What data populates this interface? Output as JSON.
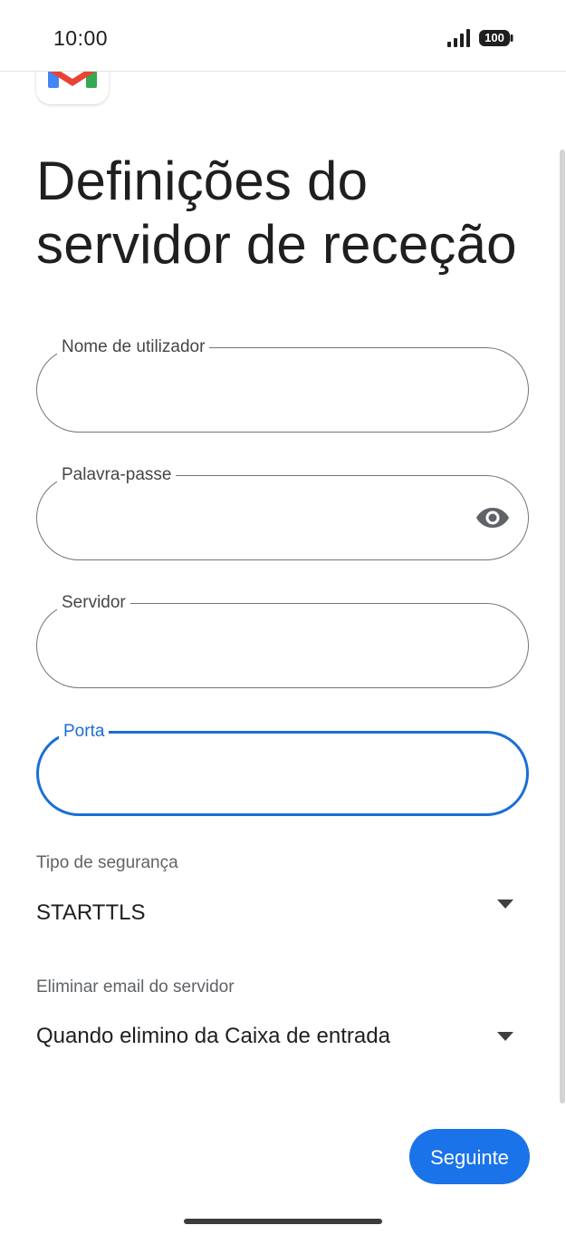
{
  "status_bar": {
    "time": "10:00",
    "battery": "100",
    "icons": [
      "signal-icon",
      "battery-icon"
    ]
  },
  "logo": {
    "icon": "gmail-logo",
    "colors": [
      "#4285f4",
      "#ea4335",
      "#34a853",
      "#fbbc04"
    ]
  },
  "page": {
    "title": "Definições do servidor de receção"
  },
  "fields": {
    "username": {
      "label": "Nome de utilizador",
      "value": ""
    },
    "password": {
      "label": "Palavra-passe",
      "value": "",
      "toggle_icon": "eye-icon"
    },
    "server": {
      "label": "Servidor",
      "value": ""
    },
    "port": {
      "label": "Porta",
      "value": "",
      "focused": true
    }
  },
  "security": {
    "label": "Tipo de segurança",
    "value": "STARTTLS",
    "icon": "dropdown-arrow-icon"
  },
  "delete_email": {
    "label": "Eliminar email do servidor",
    "value": "Quando elimino da Caixa de entrada",
    "icon": "dropdown-arrow-icon"
  },
  "actions": {
    "next_label": "Seguinte"
  },
  "colors": {
    "accent": "#1a73e8",
    "focus": "#1a6fd8",
    "outline": "#747775",
    "text": "#1f1f1f",
    "secondary_text": "#5f6368"
  }
}
